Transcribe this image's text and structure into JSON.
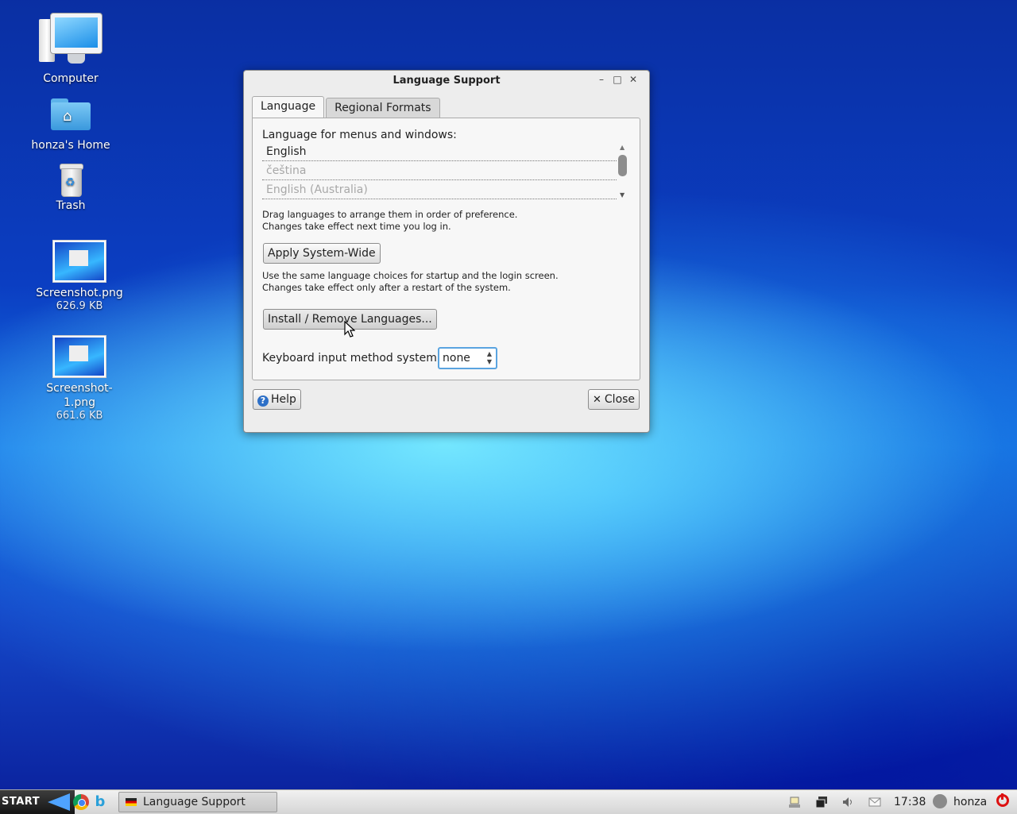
{
  "desktop": {
    "icons": [
      {
        "label": "Computer"
      },
      {
        "label": "honza's Home"
      },
      {
        "label": "Trash"
      },
      {
        "label": "Screenshot.png",
        "size": "626.9 KB"
      },
      {
        "label": "Screenshot-1.png",
        "size": "661.6 KB"
      }
    ]
  },
  "dialog": {
    "title": "Language Support",
    "window_buttons": {
      "minimize": "–",
      "maximize": "□",
      "close": "✕"
    },
    "tabs": [
      {
        "label": "Language",
        "active": true
      },
      {
        "label": "Regional Formats",
        "active": false
      }
    ],
    "language_tab": {
      "menus_label": "Language for menus and windows:",
      "languages": [
        "English",
        "čeština",
        "English (Australia)"
      ],
      "drag_hint_1": "Drag languages to arrange them in order of preference.",
      "drag_hint_2": "Changes take effect next time you log in.",
      "apply_button": "Apply System-Wide",
      "apply_hint_1": "Use the same language choices for startup and the login screen.",
      "apply_hint_2": "Changes take effect only after a restart of the system.",
      "install_button": "Install / Remove Languages...",
      "keyboard_label": "Keyboard input method system:",
      "keyboard_value": "none"
    },
    "help_button": "Help",
    "close_button": "Close"
  },
  "taskbar": {
    "start_label": "START",
    "window_button": "Language Support",
    "clock": "17:38",
    "user": "honza"
  },
  "colors": {
    "accent": "#5aa4e0",
    "power": "#dd1111"
  }
}
